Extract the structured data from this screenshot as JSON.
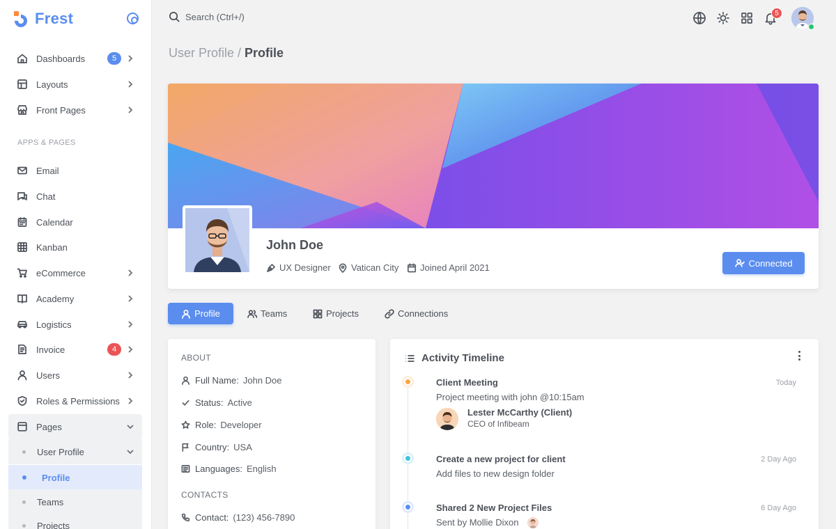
{
  "brand": {
    "name": "Frest"
  },
  "sidebar": {
    "items": [
      {
        "label": "Dashboards",
        "badge": "5"
      },
      {
        "label": "Layouts"
      },
      {
        "label": "Front Pages"
      },
      {
        "label": "Email"
      },
      {
        "label": "Chat"
      },
      {
        "label": "Calendar"
      },
      {
        "label": "Kanban"
      },
      {
        "label": "eCommerce"
      },
      {
        "label": "Academy"
      },
      {
        "label": "Logistics"
      },
      {
        "label": "Invoice",
        "badge": "4"
      },
      {
        "label": "Users"
      },
      {
        "label": "Roles & Permissions"
      },
      {
        "label": "Pages"
      }
    ],
    "section_label": "APPS & PAGES",
    "sub_items": [
      {
        "label": "User Profile"
      },
      {
        "label": "Profile"
      },
      {
        "label": "Teams"
      },
      {
        "label": "Projects"
      }
    ]
  },
  "topbar": {
    "search_placeholder": "Search (Ctrl+/)",
    "notification_count": "5"
  },
  "breadcrumb": {
    "parent": "User Profile /",
    "current": "Profile"
  },
  "profile": {
    "name": "John Doe",
    "role": "UX Designer",
    "location": "Vatican City",
    "joined": "Joined April 2021",
    "button_label": "Connected"
  },
  "tabs": [
    {
      "label": "Profile",
      "active": true
    },
    {
      "label": "Teams"
    },
    {
      "label": "Projects"
    },
    {
      "label": "Connections"
    }
  ],
  "about": {
    "heading": "ABOUT",
    "rows": [
      {
        "label": "Full Name:",
        "value": "John Doe"
      },
      {
        "label": "Status:",
        "value": "Active"
      },
      {
        "label": "Role:",
        "value": "Developer"
      },
      {
        "label": "Country:",
        "value": "USA"
      },
      {
        "label": "Languages:",
        "value": "English"
      }
    ],
    "contacts_heading": "CONTACTS",
    "contacts": [
      {
        "label": "Contact:",
        "value": "(123) 456-7890"
      }
    ]
  },
  "timeline": {
    "title": "Activity Timeline",
    "events": [
      {
        "title": "Client Meeting",
        "desc": "Project meeting with john @10:15am",
        "time": "Today",
        "color": "#f5a742"
      },
      {
        "title": "Create a new project for client",
        "desc": "Add files to new design folder",
        "time": "2 Day Ago",
        "color": "#3fc3dd"
      },
      {
        "title": "Shared 2 New Project Files",
        "desc": "Sent by Mollie Dixon",
        "time": "6 Day Ago",
        "color": "#5b8def"
      }
    ],
    "person": {
      "name": "Lester McCarthy (Client)",
      "role": "CEO of Infibeam"
    }
  },
  "colors": {
    "primary": "#5b8def",
    "danger": "#ea5455",
    "success": "#28c76f",
    "warning": "#f5a742",
    "info": "#3fc3dd"
  }
}
